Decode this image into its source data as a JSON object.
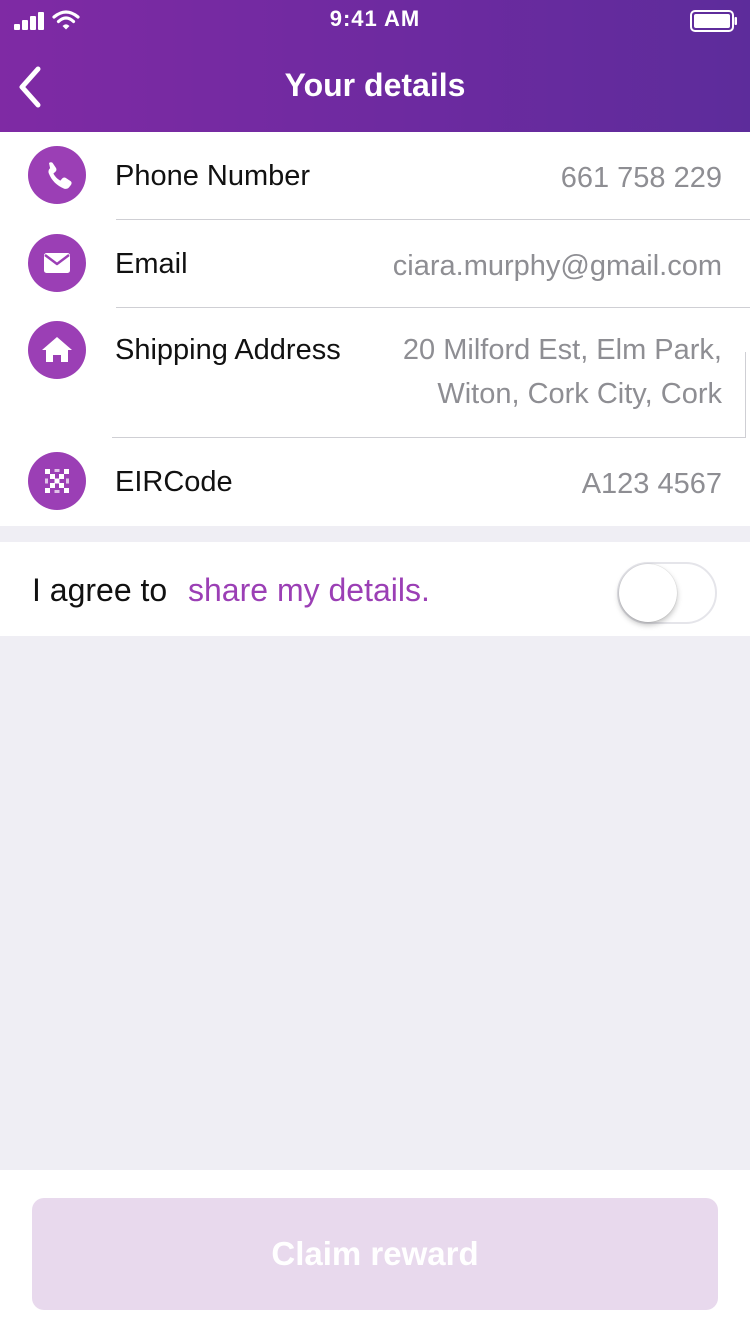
{
  "status_bar": {
    "time": "9:41 AM",
    "signal_icon": "signal-bars-icon",
    "wifi_icon": "wifi-icon",
    "battery_icon": "battery-full-icon"
  },
  "header": {
    "title": "Your details",
    "back_icon": "chevron-left-icon"
  },
  "details": [
    {
      "label": "Phone Number",
      "value": "661 758 229",
      "icon": "phone-icon"
    },
    {
      "label": "Email",
      "value": "ciara.murphy@gmail.com",
      "icon": "mail-icon"
    },
    {
      "label": "Shipping Address",
      "value_lines": [
        "20 Milford Est, Elm Park,",
        "Witon, Cork City, Cork"
      ],
      "icon": "home-icon"
    },
    {
      "label": "EIRCode",
      "value": "A123 4567",
      "icon": "eircode-icon"
    }
  ],
  "consent": {
    "prefix": "I agree to",
    "link_text": "share my details.",
    "toggle_on": false
  },
  "footer": {
    "button_label": "Claim reward",
    "button_enabled": false
  },
  "colors": {
    "brand_purple": "#9b3fb5",
    "header_gradient_start": "#7f2aa4",
    "header_gradient_end": "#5d2c9b",
    "disabled_button": "#e8d9ed",
    "value_gray": "#8e8e93",
    "background": "#efeef4"
  }
}
